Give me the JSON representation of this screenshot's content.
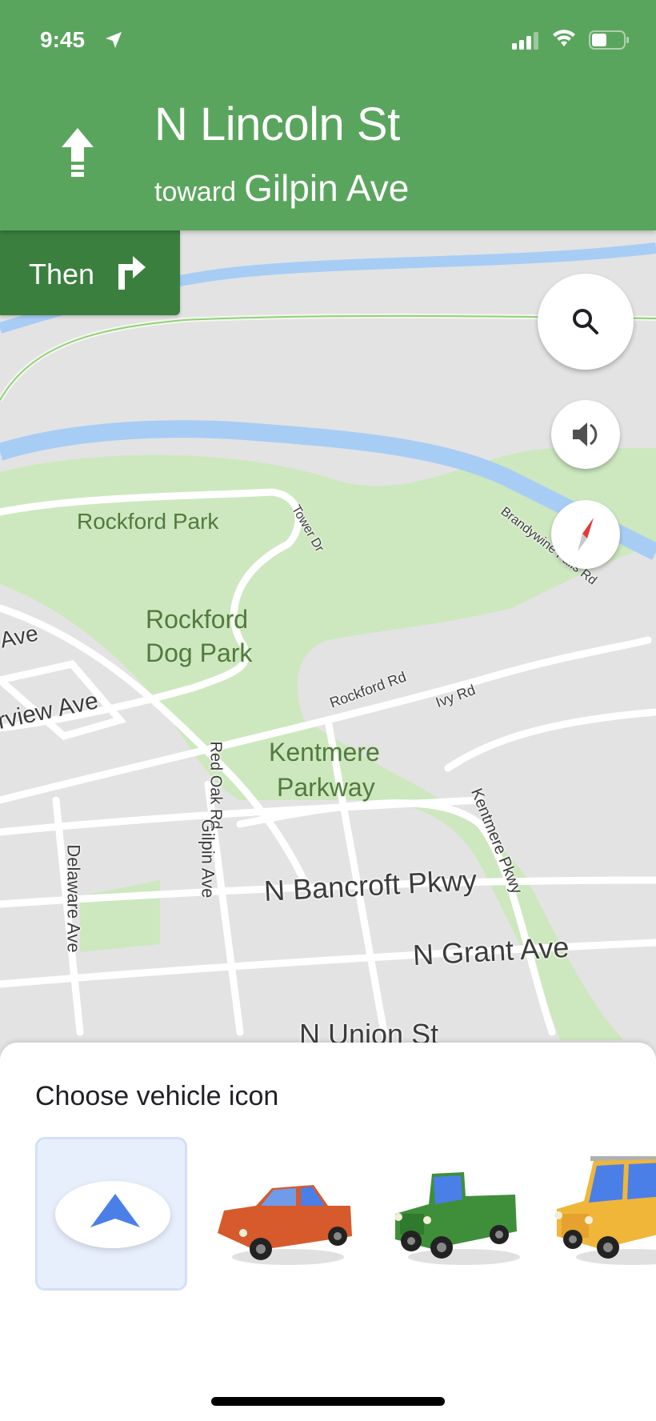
{
  "status_bar": {
    "time": "9:45",
    "location_icon": "location-arrow-icon",
    "signal_icon": "cellular-signal-icon",
    "wifi_icon": "wifi-icon",
    "battery_icon": "battery-icon"
  },
  "navigation": {
    "maneuver_icon": "straight-arrow-icon",
    "street": "N Lincoln St",
    "toward_word": "toward",
    "toward_street": "Gilpin Ave",
    "header_color": "#5aa55d",
    "then": {
      "label": "Then",
      "icon": "turn-right-icon",
      "color": "#3b7f3f"
    }
  },
  "map_controls": {
    "search": "search-icon",
    "sound": "volume-icon",
    "compass": "compass-icon"
  },
  "map_labels": {
    "rockford_park": "Rockford Park",
    "tower_dr": "Tower Dr",
    "brandywine": "Brandywine Falls Rd",
    "dog_park_1": "Rockford",
    "dog_park_2": "Dog Park",
    "ave": "Ave",
    "rview_ave": "rview Ave",
    "rockford_rd": "Rockford Rd",
    "ivy_rd": "Ivy Rd",
    "kentmere_1": "Kentmere",
    "kentmere_2": "Parkway",
    "red_oak_rd": "Red Oak Rd",
    "kentmere_pkwy": "Kentmere Pkwy",
    "gilpin_ave": "Gilpin Ave",
    "delaware_ave": "Delaware Ave",
    "bancroft": "N Bancroft Pkwy",
    "grant": "N Grant Ave",
    "union": "N Union St"
  },
  "sheet": {
    "title": "Choose vehicle icon",
    "vehicles": [
      {
        "name": "Navigation arrow",
        "color": "#4a7fe8",
        "selected": true
      },
      {
        "name": "Red sedan",
        "color": "#d65a2b",
        "selected": false
      },
      {
        "name": "Green pickup truck",
        "color": "#3f8f3a",
        "selected": false
      },
      {
        "name": "Yellow SUV",
        "color": "#f0b63a",
        "selected": false
      }
    ]
  }
}
